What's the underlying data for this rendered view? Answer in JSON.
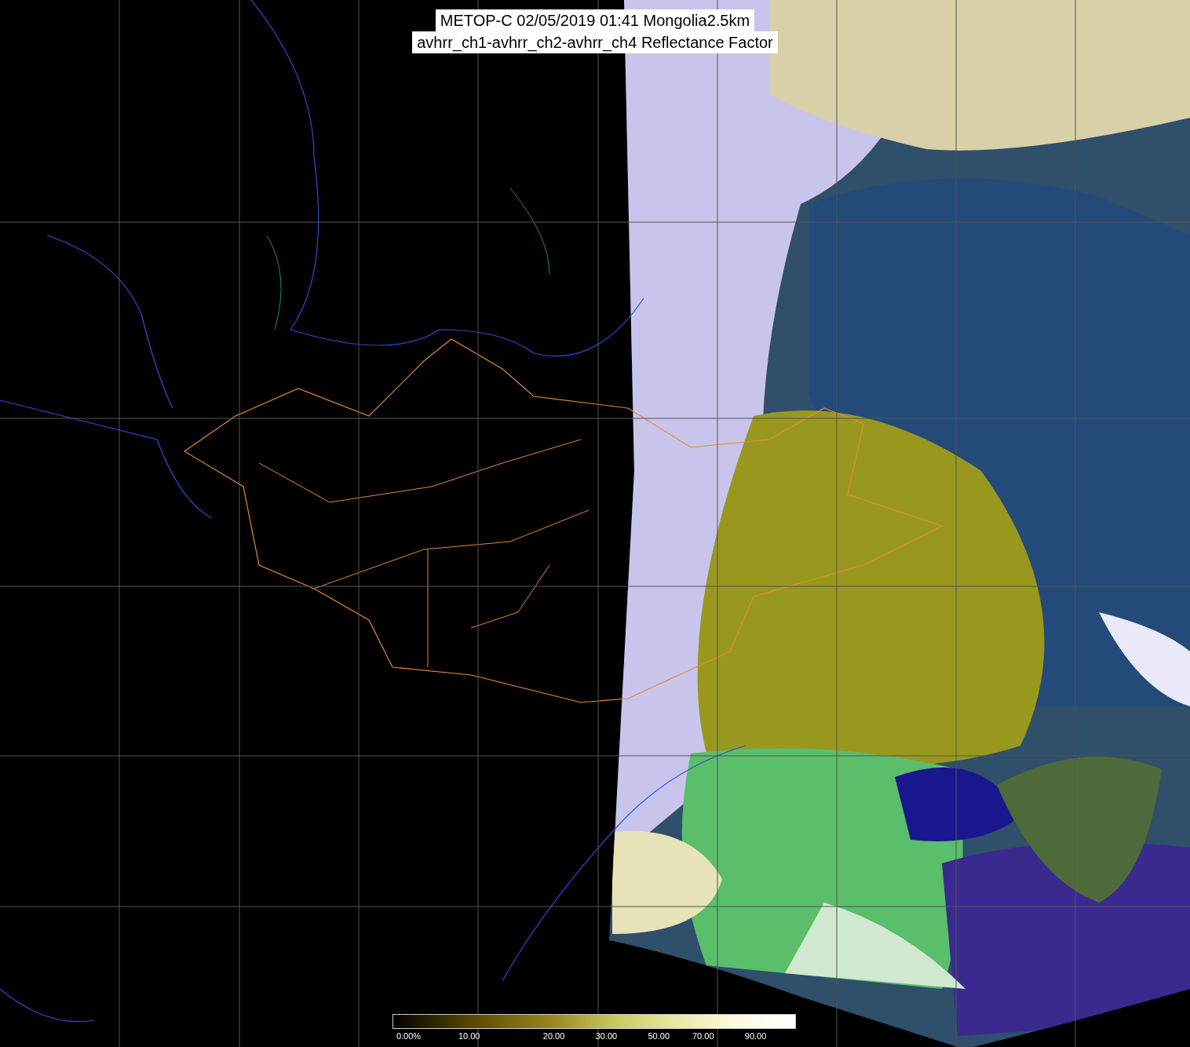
{
  "title": {
    "lines": [
      "METOP-C 02/05/2019 01:41 Mongolia2.5km",
      "avhrr_ch1-avhrr_ch2-avhrr_ch4 Reflectance Factor"
    ]
  },
  "colorbar": {
    "ticks": [
      "0.00%",
      "10.00",
      "20.00",
      "30.00",
      "50.00",
      "70.00",
      "90.00"
    ]
  }
}
